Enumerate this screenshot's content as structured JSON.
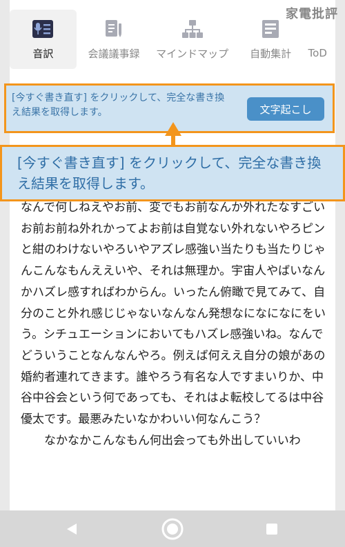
{
  "watermark": "家電批評",
  "tabs": [
    {
      "label": "音訳",
      "icon": "microphone-icon",
      "active": true
    },
    {
      "label": "会議議事録",
      "icon": "document-icon",
      "active": false
    },
    {
      "label": "マインドマップ",
      "icon": "mindmap-icon",
      "active": false
    },
    {
      "label": "自動集計",
      "icon": "summary-icon",
      "active": false
    },
    {
      "label": "ToD",
      "icon": "todo-icon",
      "active": false
    }
  ],
  "tip": {
    "text": "[今すぐ書き直す] をクリックして、完全な書き換え結果を取得します。",
    "button": "文字起こし"
  },
  "callout": {
    "text": "[今すぐ書き直す] をクリックして、完全な書き換え結果を取得します。"
  },
  "transcript": {
    "paragraph1": "なんで何しねえやお前、変でもお前なんか外れたなすごいお前お前ね外れかってよお前は自覚ない外れないやろピンと紺のわけないやろいやアズレ感強い当たりも当たりじゃんこんなもんええいや、それは無理か。宇宙人やばいなんかハズレ感すればわからん。いったん俯瞰で見てみて、自分のこと外れ感じじゃないなんなん発想なになになにをいう。シチュエーションにおいてもハズレ感強いね。なんでどういうことなんなんやろ。例えば何ええ自分の娘があの婚約者連れてきます。誰やろう有名な人ですまいりか、中谷中谷会という何であっても、それはよ転校してるは中谷優太です。最悪みたいなかわいい何なんこう？",
    "paragraph2": "なかなかこんなもん何出会っても外出していいわ"
  },
  "colors": {
    "accent": "#4a90c8",
    "highlight_border": "#f3951c",
    "tip_background": "#cfe3f2"
  },
  "navbar": {
    "back": "back-triangle-icon",
    "home": "home-circle-icon",
    "recents": "recents-square-icon"
  }
}
